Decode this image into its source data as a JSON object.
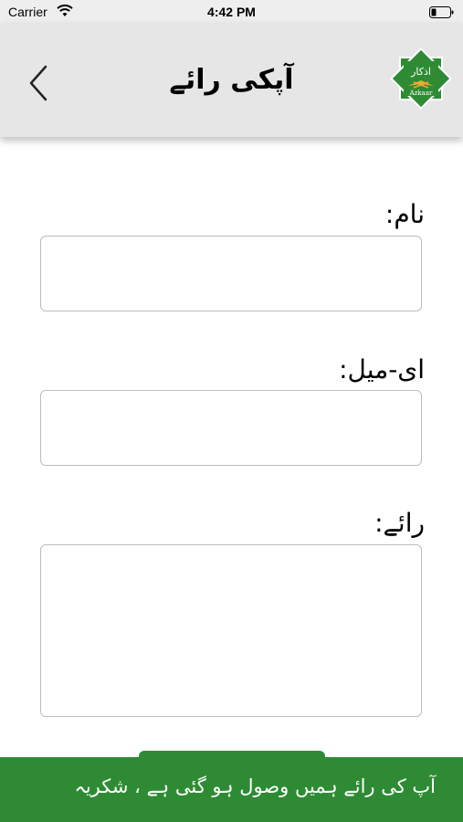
{
  "status_bar": {
    "carrier": "Carrier",
    "time": "4:42 PM",
    "wifi_icon": "wifi-icon",
    "battery_icon": "battery-icon"
  },
  "nav": {
    "title": "آپکی رائے",
    "back_icon": "chevron-left-icon",
    "logo_text_ur": "اذکار",
    "logo_text_en": "Azkaar"
  },
  "form": {
    "name_label": "نام:",
    "name_value": "",
    "email_label": "ای-میل:",
    "email_value": "",
    "feedback_label": "رائے:",
    "feedback_value": ""
  },
  "toast": {
    "message": "آپ کی رائے ہمیں وصول ہو گئی ہے ، شکریہ"
  },
  "colors": {
    "accent_green": "#2e8b34",
    "nav_background": "#e6e6e6"
  }
}
